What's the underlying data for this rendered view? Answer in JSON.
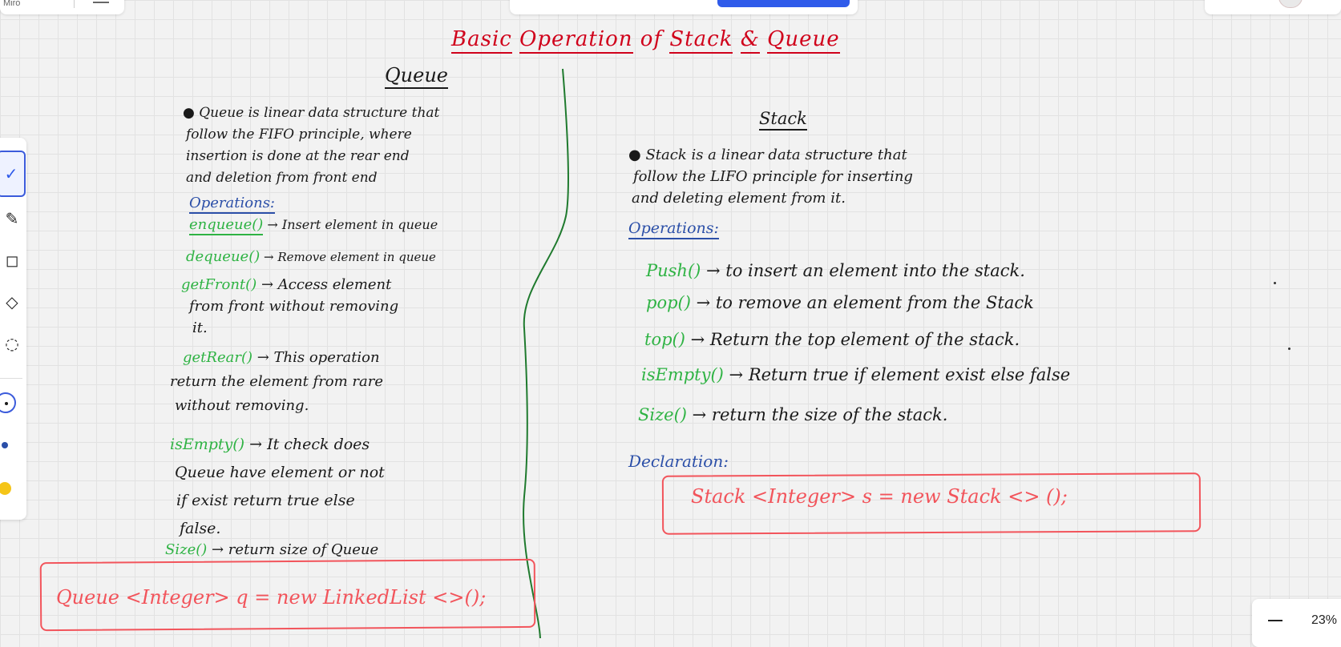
{
  "app": {
    "brand": "Miro"
  },
  "zoom": {
    "level": "23%"
  },
  "board": {
    "title_parts": [
      "Basic",
      "Operation",
      "of",
      "Stack",
      "&",
      "Queue"
    ],
    "queue": {
      "heading": "Queue",
      "definition": [
        "Queue is linear data structure that",
        "follow the FIFO principle, where",
        "insertion is done at the rear end",
        "and deletion from front end"
      ],
      "operations_label": "Operations:",
      "ops": [
        {
          "name": "enqueue()",
          "desc": [
            " → Insert element in queue"
          ]
        },
        {
          "name": "dequeue()",
          "desc": [
            " → Remove element in queue"
          ]
        },
        {
          "name": "getFront()",
          "desc": [
            " → Access element",
            "from front without removing",
            "it."
          ]
        },
        {
          "name": "getRear()",
          "desc": [
            " → This operation",
            "return the element from rare",
            "without removing."
          ]
        },
        {
          "name": "isEmpty()",
          "desc": [
            " → It check does",
            "Queue have element or not",
            "if exist return true else",
            "false."
          ]
        },
        {
          "name": "Size()",
          "desc": [
            " → return size of Queue"
          ]
        }
      ],
      "code": "Queue <Integer> q = new LinkedList <>();"
    },
    "stack": {
      "heading": "Stack",
      "definition": [
        "Stack is a linear data structure that",
        "follow the LIFO principle for inserting",
        "and deleting element from it."
      ],
      "operations_label": "Operations:",
      "ops": [
        {
          "name": "Push()",
          "desc": " → to insert an element into the stack."
        },
        {
          "name": "pop()",
          "desc": " → to remove an element from the Stack"
        },
        {
          "name": "top()",
          "desc": " → Return the top element of the stack."
        },
        {
          "name": "isEmpty()",
          "desc": " → Return true if element exist else false"
        },
        {
          "name": "Size()",
          "desc": " → return the size of the stack."
        }
      ],
      "declaration_label": "Declaration:",
      "code": "Stack <Integer> s = new Stack <> ();"
    }
  },
  "toolbar": {
    "tools": [
      "pen-icon",
      "highlighter-icon",
      "shape-icon",
      "eraser-icon",
      "lasso-icon"
    ],
    "colors": [
      "#1a1a1a",
      "#2b4fa8",
      "#f5c518"
    ]
  },
  "colors": {
    "ink_black": "#1a1a1a",
    "ink_red": "#d0021b",
    "ink_green": "#2fb344",
    "ink_blue": "#2b4fa8",
    "ink_salmon": "#f2545b",
    "divider_green": "#1f7a2e",
    "accent": "#2f5bea"
  }
}
